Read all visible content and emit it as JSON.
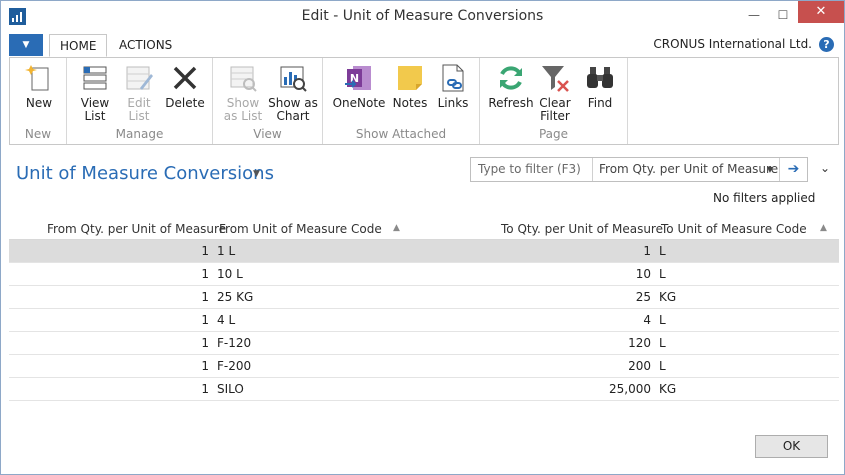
{
  "window": {
    "title": "Edit - Unit of Measure Conversions",
    "minimize": "—",
    "maximize": "☐",
    "close": "✕"
  },
  "ribbon_tabs": {
    "file": "▼",
    "home": "HOME",
    "actions": "ACTIONS",
    "company": "CRONUS International Ltd.",
    "help": "?"
  },
  "ribbon": {
    "groups": {
      "new": "New",
      "manage": "Manage",
      "view": "View",
      "show_attached": "Show Attached",
      "page": "Page"
    },
    "buttons": {
      "new": "New",
      "view_list_1": "View",
      "view_list_2": "List",
      "edit_list_1": "Edit",
      "edit_list_2": "List",
      "delete": "Delete",
      "show_as_list_1": "Show",
      "show_as_list_2": "as List",
      "show_as_chart_1": "Show as",
      "show_as_chart_2": "Chart",
      "onenote": "OneNote",
      "notes": "Notes",
      "links": "Links",
      "refresh": "Refresh",
      "clear_filter_1": "Clear",
      "clear_filter_2": "Filter",
      "find": "Find"
    }
  },
  "page": {
    "title": "Unit of Measure Conversions",
    "title_caret": "▼",
    "filter_placeholder": "Type to filter (F3)",
    "filter_field": "From Qty. per Unit of Measure",
    "filter_caret": "▼",
    "filter_go": "➔",
    "collapse": "⌄",
    "no_filters": "No filters applied"
  },
  "table": {
    "columns": {
      "from_qty": "From Qty. per Unit of Measure",
      "from_code": "From Unit of Measure Code",
      "to_qty": "To Qty. per Unit of Measure",
      "to_code": "To Unit of Measure Code"
    },
    "sort_arrow": "▲",
    "rows": [
      {
        "from_qty": "1",
        "from_code": "1 L",
        "to_qty": "1",
        "to_code": "L"
      },
      {
        "from_qty": "1",
        "from_code": "10 L",
        "to_qty": "10",
        "to_code": "L"
      },
      {
        "from_qty": "1",
        "from_code": "25 KG",
        "to_qty": "25",
        "to_code": "KG"
      },
      {
        "from_qty": "1",
        "from_code": "4 L",
        "to_qty": "4",
        "to_code": "L"
      },
      {
        "from_qty": "1",
        "from_code": "F-120",
        "to_qty": "120",
        "to_code": "L"
      },
      {
        "from_qty": "1",
        "from_code": "F-200",
        "to_qty": "200",
        "to_code": "L"
      },
      {
        "from_qty": "1",
        "from_code": "SILO",
        "to_qty": "25,000",
        "to_code": "KG"
      }
    ]
  },
  "footer": {
    "ok": "OK"
  },
  "colors": {
    "accent": "#2a6cb5",
    "selected_row": "#dcdcdc",
    "close_button": "#c7504e",
    "onenote": "#7d3c98",
    "notes": "#f2c94c",
    "refresh": "#3aa673",
    "delete": "#333333"
  }
}
